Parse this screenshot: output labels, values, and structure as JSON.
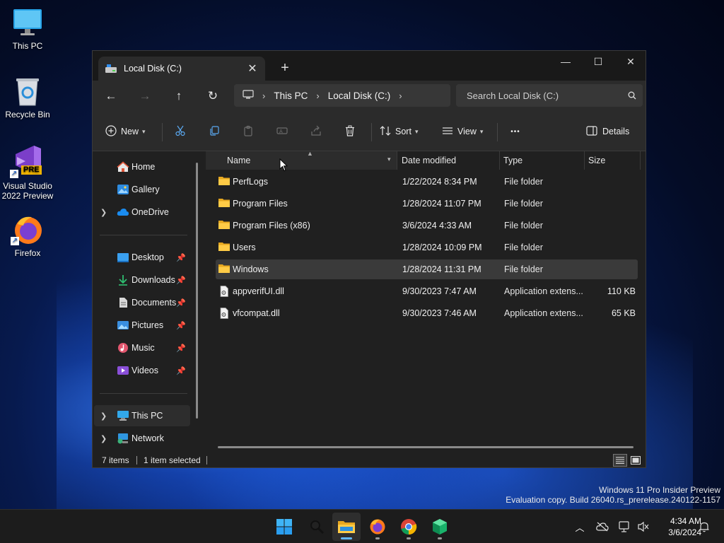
{
  "desktop": {
    "icons": [
      {
        "label": "This PC"
      },
      {
        "label": "Recycle Bin"
      },
      {
        "label_line1": "Visual Studio",
        "label_line2": "2022 Preview",
        "badge": "PRE"
      },
      {
        "label": "Firefox"
      }
    ]
  },
  "window": {
    "tab_title": "Local Disk (C:)",
    "tab_close": "✕",
    "new_tab": "+",
    "controls": {
      "minimize": "—",
      "maximize": "☐",
      "close": "✕"
    },
    "nav": {
      "back": "←",
      "forward": "→",
      "up": "↑",
      "refresh": "↻"
    },
    "breadcrumb": [
      "This PC",
      "Local Disk (C:)"
    ],
    "search_placeholder": "Search Local Disk (C:)",
    "commands": {
      "new": "New",
      "sort": "Sort",
      "view": "View",
      "more": "•••",
      "details": "Details"
    },
    "navpane": {
      "quick": [
        {
          "label": "Home",
          "icon": "home-icon"
        },
        {
          "label": "Gallery",
          "icon": "gallery-icon"
        },
        {
          "label": "OneDrive",
          "icon": "cloud-icon"
        }
      ],
      "pinned": [
        {
          "label": "Desktop",
          "icon": "desktop-icon"
        },
        {
          "label": "Downloads",
          "icon": "download-icon"
        },
        {
          "label": "Documents",
          "icon": "documents-icon"
        },
        {
          "label": "Pictures",
          "icon": "pictures-icon"
        },
        {
          "label": "Music",
          "icon": "music-icon"
        },
        {
          "label": "Videos",
          "icon": "videos-icon"
        }
      ],
      "locations": [
        {
          "label": "This PC",
          "icon": "computer-icon"
        },
        {
          "label": "Network",
          "icon": "network-icon"
        }
      ]
    },
    "columns": {
      "name": "Name",
      "date": "Date modified",
      "type": "Type",
      "size": "Size"
    },
    "files": [
      {
        "name": "PerfLogs",
        "date": "1/22/2024 8:34 PM",
        "type": "File folder",
        "size": "",
        "kind": "folder"
      },
      {
        "name": "Program Files",
        "date": "1/28/2024 11:07 PM",
        "type": "File folder",
        "size": "",
        "kind": "folder"
      },
      {
        "name": "Program Files (x86)",
        "date": "3/6/2024 4:33 AM",
        "type": "File folder",
        "size": "",
        "kind": "folder"
      },
      {
        "name": "Users",
        "date": "1/28/2024 10:09 PM",
        "type": "File folder",
        "size": "",
        "kind": "folder"
      },
      {
        "name": "Windows",
        "date": "1/28/2024 11:31 PM",
        "type": "File folder",
        "size": "",
        "kind": "folder"
      },
      {
        "name": "appverifUI.dll",
        "date": "9/30/2023 7:47 AM",
        "type": "Application extens...",
        "size": "110 KB",
        "kind": "dll"
      },
      {
        "name": "vfcompat.dll",
        "date": "9/30/2023 7:46 AM",
        "type": "Application extens...",
        "size": "65 KB",
        "kind": "dll"
      }
    ],
    "status": {
      "count": "7 items",
      "selected": "1 item selected"
    }
  },
  "watermark": {
    "line1": "Windows 11 Pro Insider Preview",
    "line2": "Evaluation copy. Build 26040.rs_prerelease.240122-1157"
  },
  "taskbar": {
    "time": "4:34 AM",
    "date": "3/6/2024"
  }
}
